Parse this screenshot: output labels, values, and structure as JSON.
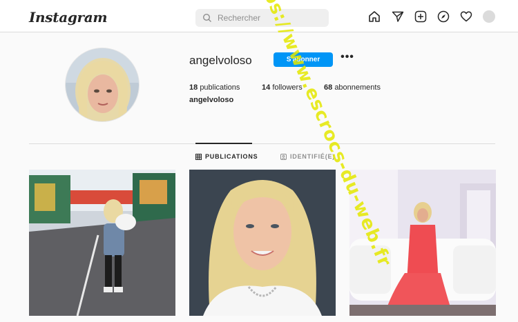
{
  "nav": {
    "logo": "Instagram",
    "search_placeholder": "Rechercher",
    "icons": [
      "home-icon",
      "direct-message-icon",
      "new-post-icon",
      "explore-icon",
      "activity-heart-icon",
      "profile-avatar-icon"
    ]
  },
  "profile": {
    "username": "angelvoloso",
    "follow_label": "S'abonner",
    "more_label": "•••",
    "posts_count": "18",
    "posts_label": "publications",
    "followers_count": "14",
    "followers_label": "followers",
    "following_count": "68",
    "following_label": "abonnements",
    "full_name": "angelvoloso"
  },
  "tabs": {
    "publications": "PUBLICATIONS",
    "tagged": "IDENTIFIÉ(E)"
  },
  "posts": [
    {
      "subject": "woman on fairground street"
    },
    {
      "subject": "blonde woman portrait"
    },
    {
      "subject": "woman in red dress on white sofa"
    }
  ],
  "watermark": "https://www.escrocs-du-web.fr",
  "colors": {
    "accent": "#0095f6",
    "watermark": "#e4e800"
  }
}
